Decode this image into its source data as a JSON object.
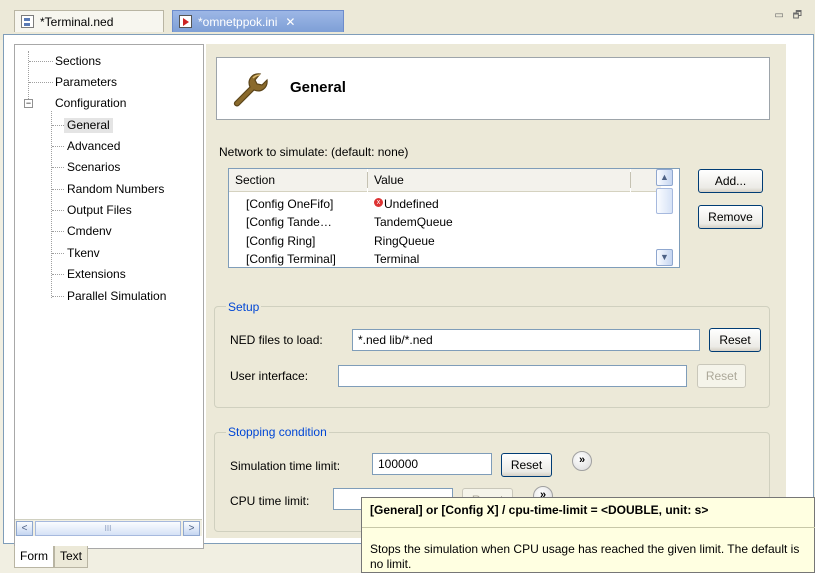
{
  "tabs": [
    {
      "label": "*Terminal.ned",
      "icon": "ned-file-icon",
      "active": false
    },
    {
      "label": "*omnetppok.ini",
      "icon": "ini-file-icon",
      "active": true
    }
  ],
  "window_controls": {
    "minimize": "▭",
    "restore": "🗗"
  },
  "tree": {
    "items": [
      {
        "label": "Sections",
        "level": 0
      },
      {
        "label": "Parameters",
        "level": 0
      },
      {
        "label": "Configuration",
        "level": 0,
        "expanded": true,
        "expander": "−"
      },
      {
        "label": "General",
        "level": 1,
        "selected": true
      },
      {
        "label": "Advanced",
        "level": 1
      },
      {
        "label": "Scenarios",
        "level": 1
      },
      {
        "label": "Random Numbers",
        "level": 1
      },
      {
        "label": "Output Files",
        "level": 1
      },
      {
        "label": "Cmdenv",
        "level": 1
      },
      {
        "label": "Tkenv",
        "level": 1
      },
      {
        "label": "Extensions",
        "level": 1
      },
      {
        "label": "Parallel Simulation",
        "level": 1
      }
    ],
    "scroll_left": "<",
    "scroll_right": ">",
    "scroll_grip": "III"
  },
  "bottom_tabs": [
    {
      "label": "Form",
      "active": true
    },
    {
      "label": "Text",
      "active": false
    }
  ],
  "header": {
    "title": "General",
    "icon": "wrench-icon"
  },
  "network": {
    "label": "Network to simulate:  (default: none)",
    "columns": [
      "Section",
      "Value"
    ],
    "rows": [
      {
        "section": "[Config OneFifo]",
        "value": "Undefined",
        "error": true
      },
      {
        "section": "[Config Tande…",
        "value": "TandemQueue",
        "error": false
      },
      {
        "section": "[Config Ring]",
        "value": "RingQueue",
        "error": false
      },
      {
        "section": "[Config Terminal]",
        "value": "Terminal",
        "error": false
      }
    ],
    "error_mark": "x",
    "scroll_up": "▲",
    "scroll_down": "▼",
    "add_label": "Add...",
    "remove_label": "Remove"
  },
  "setup": {
    "title": "Setup",
    "ned_label": "NED files to load:",
    "ned_value": "*.ned lib/*.ned",
    "ned_reset": "Reset",
    "ui_label": "User interface:",
    "ui_value": "",
    "ui_reset": "Reset"
  },
  "stopping": {
    "title": "Stopping condition",
    "sim_label": "Simulation time limit:",
    "sim_value": "100000",
    "sim_reset": "Reset",
    "cpu_label": "CPU time limit:",
    "cpu_value": "",
    "cpu_reset": "Reset",
    "more_symbol": "»"
  },
  "tooltip": {
    "title": "[General] or [Config X] / cpu-time-limit = <DOUBLE, unit: s>",
    "body": "Stops the simulation when CPU usage has reached the given limit. The default is no limit."
  },
  "colors": {
    "accent": "#0046d5",
    "active_tab": "#7e9fd6",
    "error": "#dd3333",
    "tooltip_bg": "#ffffe1"
  }
}
